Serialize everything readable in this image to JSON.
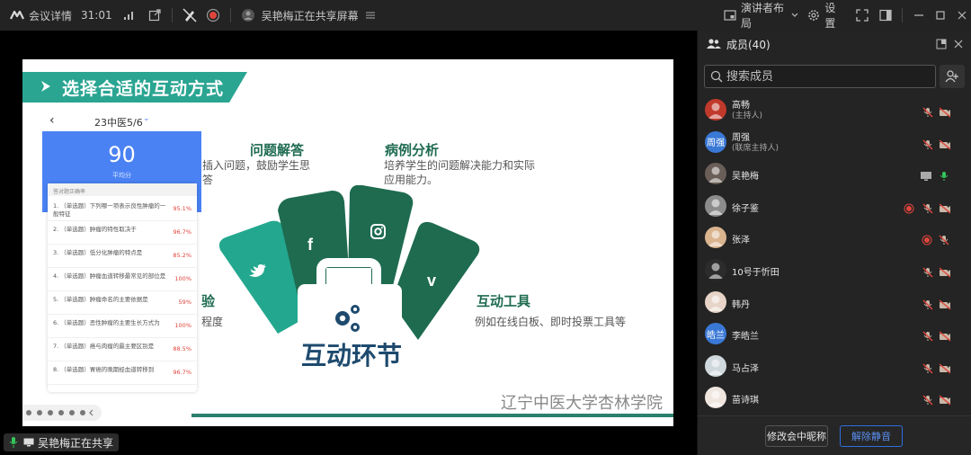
{
  "topbar": {
    "meeting_info_label": "会议详情",
    "duration": "31:01",
    "sharing_status": "吴艳梅正在共享屏幕",
    "layout_label": "演讲者布局",
    "settings_label": "设置"
  },
  "slide": {
    "title": "选择合适的互动方式",
    "phone": {
      "class_name": "23中医5/6",
      "score": "90",
      "score_label": "平均分",
      "card_header": "答对题正确率",
      "questions": [
        {
          "text": "1. （单选题）下列哪一项表示良性肿瘤的一般特征",
          "pct": "95.1%"
        },
        {
          "text": "2. （单选题）肿瘤的特性取决于",
          "pct": "96.7%"
        },
        {
          "text": "3. （单选题）低分化肿瘤的特点是",
          "pct": "85.2%"
        },
        {
          "text": "4. （单选题）肿瘤血道转移最常见的部位是",
          "pct": "100%"
        },
        {
          "text": "5. （单选题）肿瘤命名的主要依据是",
          "pct": "59%"
        },
        {
          "text": "6. （单选题）恶性肿瘤的主要生长方式为",
          "pct": "100%"
        },
        {
          "text": "7. （单选题）癌与肉瘤的最主要区别是",
          "pct": "88.5%"
        },
        {
          "text": "8. （单选题）胃癌的晚期经血道转移到",
          "pct": "96.7%"
        }
      ]
    },
    "features": {
      "qa_title": "问题解答",
      "qa_desc_line1": "插入问题，鼓励学生思",
      "qa_desc_line2": "答",
      "case_title": "病例分析",
      "case_desc_line1": "培养学生的问题解决能力和实际",
      "case_desc_line2": "应用能力。",
      "exp_title": "验",
      "exp_desc": "程度",
      "tools_title": "互动工具",
      "tools_desc": "例如在线白板、即时投票工具等"
    },
    "center_label": "互动环节",
    "watermark": "辽宁中医大学杏林学院"
  },
  "bottom_status": "吴艳梅正在共享",
  "panel": {
    "title": "成员(40)",
    "search_placeholder": "搜索成员",
    "members": [
      {
        "name": "高畅",
        "role": "(主持人)",
        "avatar_text": "",
        "avatar_color": "#c0392b",
        "mic": "muted",
        "cam": "off",
        "rec": false
      },
      {
        "name": "周强",
        "role": "(联席主持人)",
        "avatar_text": "周强",
        "avatar_color": "#3a78d6",
        "mic": "muted",
        "cam": "off",
        "rec": false
      },
      {
        "name": "吴艳梅",
        "role": "",
        "avatar_text": "",
        "avatar_color": "#6a5e58",
        "mic": "active",
        "cam": "share",
        "rec": false
      },
      {
        "name": "徐子鉴",
        "role": "",
        "avatar_text": "",
        "avatar_color": "#8c8c8c",
        "mic": "muted",
        "cam": "off",
        "rec": true
      },
      {
        "name": "张泽",
        "role": "",
        "avatar_text": "",
        "avatar_color": "#d9b48f",
        "mic": "muted",
        "cam": "none",
        "rec": true
      },
      {
        "name": "10号于忻田",
        "role": "",
        "avatar_text": "",
        "avatar_color": "#2c2c2c",
        "mic": "muted",
        "cam": "off",
        "rec": false
      },
      {
        "name": "韩丹",
        "role": "",
        "avatar_text": "",
        "avatar_color": "#e7d4c8",
        "mic": "muted",
        "cam": "off",
        "rec": false
      },
      {
        "name": "李皓兰",
        "role": "",
        "avatar_text": "皓兰",
        "avatar_color": "#3a78d6",
        "mic": "muted",
        "cam": "off",
        "rec": false
      },
      {
        "name": "马占泽",
        "role": "",
        "avatar_text": "",
        "avatar_color": "#cfd8dc",
        "mic": "muted",
        "cam": "off",
        "rec": false
      },
      {
        "name": "苗诗琪",
        "role": "",
        "avatar_text": "",
        "avatar_color": "#f0e6e0",
        "mic": "muted",
        "cam": "off",
        "rec": false
      }
    ],
    "rename_button": "修改会中昵称",
    "unmute_button": "解除静音"
  },
  "colors": {
    "accent": "#2aa592",
    "dark_green": "#1e6b50",
    "muted_red": "#e0453c",
    "active_green": "#34c759",
    "primary_blue": "#2f6fe0"
  }
}
